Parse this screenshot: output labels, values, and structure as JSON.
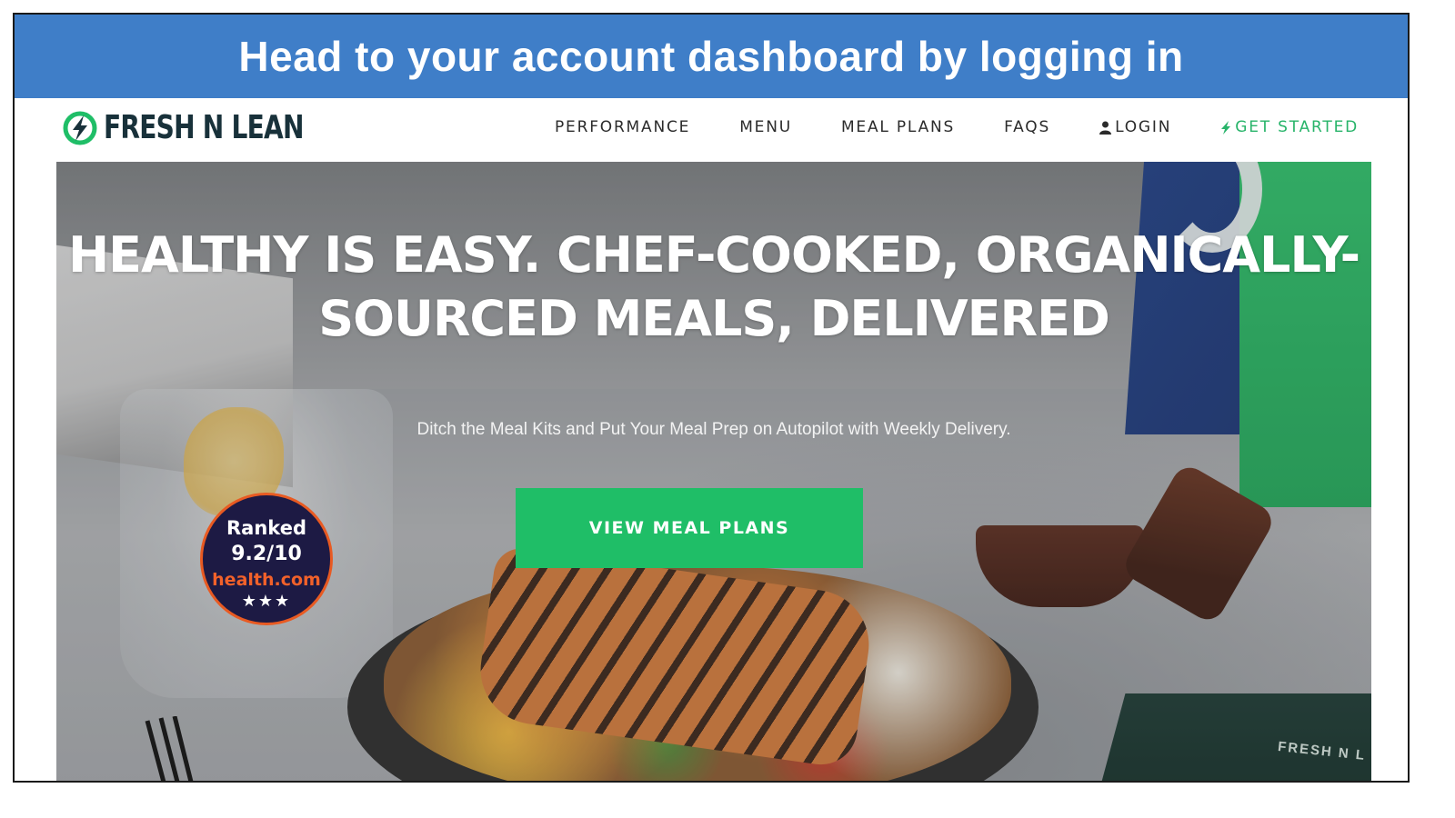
{
  "banner": {
    "text": "Head to your account dashboard by logging in"
  },
  "logo": {
    "text": "FRESH N LEAN"
  },
  "nav": {
    "items": [
      {
        "label": "PERFORMANCE"
      },
      {
        "label": "MENU"
      },
      {
        "label": "MEAL PLANS"
      },
      {
        "label": "FAQS"
      },
      {
        "label": "LOGIN",
        "icon": "user-icon"
      },
      {
        "label": "GET STARTED",
        "icon": "lightning-icon"
      }
    ]
  },
  "hero": {
    "headline": "HEALTHY IS EASY. CHEF-COOKED, ORGANICALLY-SOURCED MEALS, DELIVERED",
    "subheadline": "Ditch the Meal Kits and Put Your Meal Prep on Autopilot with Weekly Delivery.",
    "cta_label": "VIEW MEAL PLANS",
    "package_text": "FRESH N L"
  },
  "badge": {
    "line1": "Ranked",
    "line2": "9.2/10",
    "line3": "health.com",
    "stars": "★★★"
  },
  "colors": {
    "banner": "#3f7ec8",
    "brand_green": "#1fbe67",
    "cta_nav": "#28b46a",
    "logo_dark": "#18313a",
    "badge_bg": "#1d1a44",
    "badge_accent": "#e85a22"
  }
}
